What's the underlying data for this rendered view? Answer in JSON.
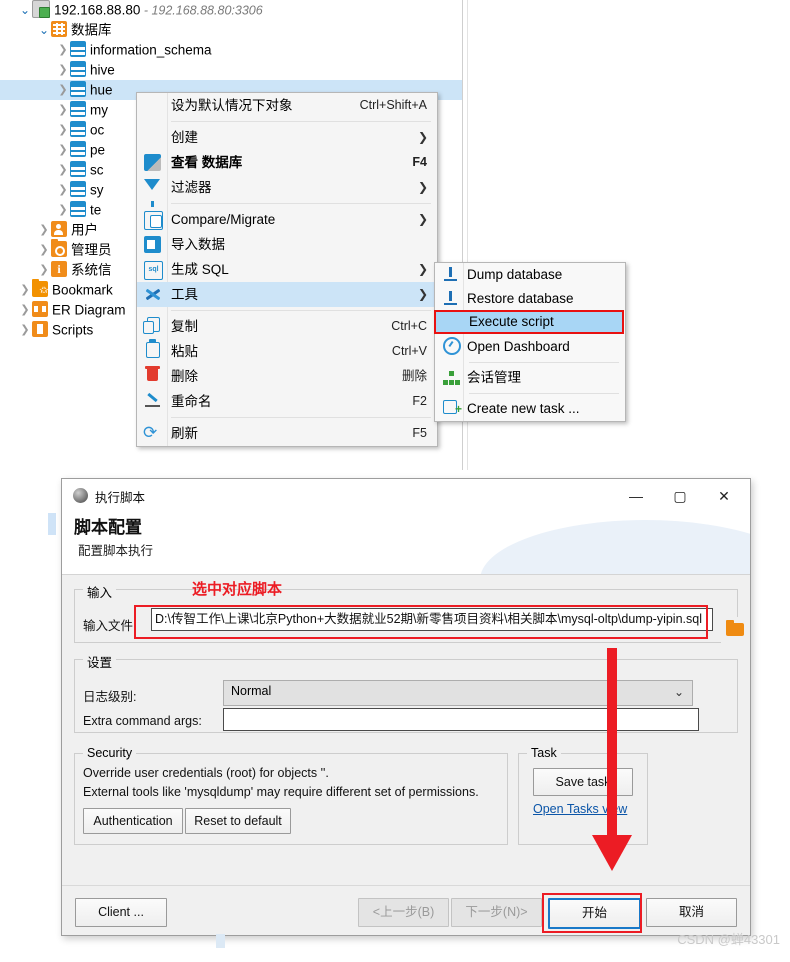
{
  "tree": {
    "items": [
      {
        "label": "192.168.88.80",
        "sub": "- 192.168.88.80:3306",
        "icon": "server-icon",
        "indent": 1,
        "twisty": "open"
      },
      {
        "label": "数据库",
        "sub": "",
        "icon": "grid-icon",
        "indent": 2,
        "twisty": "open"
      },
      {
        "label": "information_schema",
        "sub": "",
        "icon": "database-icon",
        "indent": 3,
        "twisty": "closed"
      },
      {
        "label": "hive",
        "sub": "",
        "icon": "database-icon",
        "indent": 3,
        "twisty": "closed"
      },
      {
        "label": "hue",
        "sub": "",
        "icon": "database-icon",
        "indent": 3,
        "twisty": "closed"
      },
      {
        "label": "my",
        "sub": "",
        "icon": "database-icon",
        "indent": 3,
        "twisty": "closed"
      },
      {
        "label": "oc",
        "sub": "",
        "icon": "database-icon",
        "indent": 3,
        "twisty": "closed"
      },
      {
        "label": "pe",
        "sub": "",
        "icon": "database-icon",
        "indent": 3,
        "twisty": "closed"
      },
      {
        "label": "sc",
        "sub": "",
        "icon": "database-icon",
        "indent": 3,
        "twisty": "closed"
      },
      {
        "label": "sy",
        "sub": "",
        "icon": "database-icon",
        "indent": 3,
        "twisty": "closed"
      },
      {
        "label": "te",
        "sub": "",
        "icon": "database-icon",
        "indent": 3,
        "twisty": "closed"
      },
      {
        "label": "用户",
        "sub": "",
        "icon": "user-icon",
        "indent": 2,
        "twisty": "closed"
      },
      {
        "label": "管理员",
        "sub": "",
        "icon": "key-folder-icon",
        "indent": 2,
        "twisty": "closed"
      },
      {
        "label": "系统信",
        "sub": "",
        "icon": "info-icon",
        "indent": 2,
        "twisty": "closed"
      },
      {
        "label": "Bookmark",
        "sub": "",
        "icon": "bookmark-folder-icon",
        "indent": 1,
        "twisty": "closed"
      },
      {
        "label": "ER Diagram",
        "sub": "",
        "icon": "er-diagram-icon",
        "indent": 1,
        "twisty": "closed"
      },
      {
        "label": "Scripts",
        "sub": "",
        "icon": "scripts-folder-icon",
        "indent": 1,
        "twisty": "closed"
      }
    ],
    "selected_index": 4
  },
  "context_menu": {
    "items": [
      {
        "label": "设为默认情况下对象",
        "accel": "Ctrl+Shift+A",
        "icon": "",
        "arrow": false,
        "bold": false
      },
      {
        "sep": true
      },
      {
        "label": "创建",
        "accel": "",
        "icon": "",
        "arrow": true,
        "bold": false
      },
      {
        "label": "查看 数据库",
        "accel": "F4",
        "icon": "pencil-icon",
        "arrow": false,
        "bold": true
      },
      {
        "label": "过滤器",
        "accel": "",
        "icon": "filter-icon",
        "arrow": true,
        "bold": false
      },
      {
        "sep": true
      },
      {
        "label": "Compare/Migrate",
        "accel": "",
        "icon": "compare-icon",
        "arrow": true,
        "bold": false
      },
      {
        "label": "导入数据",
        "accel": "",
        "icon": "import-icon",
        "arrow": false,
        "bold": false
      },
      {
        "label": "生成 SQL",
        "accel": "",
        "icon": "sql-icon",
        "arrow": true,
        "bold": false
      },
      {
        "label": "工具",
        "accel": "",
        "icon": "tools-icon",
        "arrow": true,
        "bold": false,
        "highlighted": true
      },
      {
        "sep": true
      },
      {
        "label": "复制",
        "accel": "Ctrl+C",
        "icon": "copy-icon",
        "arrow": false,
        "bold": false
      },
      {
        "label": "粘贴",
        "accel": "Ctrl+V",
        "icon": "paste-icon",
        "arrow": false,
        "bold": false
      },
      {
        "label": "删除",
        "accel": "删除",
        "icon": "trash-icon",
        "arrow": false,
        "bold": false
      },
      {
        "label": "重命名",
        "accel": "F2",
        "icon": "rename-icon",
        "arrow": false,
        "bold": false
      },
      {
        "sep": true
      },
      {
        "label": "刷新",
        "accel": "F5",
        "icon": "refresh-icon",
        "arrow": false,
        "bold": false
      }
    ]
  },
  "sub_menu": {
    "items": [
      {
        "label": "Dump database",
        "icon": "upload-icon"
      },
      {
        "label": "Restore database",
        "icon": "download-icon"
      },
      {
        "label": "Execute script",
        "icon": "",
        "highlighted": true
      },
      {
        "label": "Open Dashboard",
        "icon": "gauge-icon"
      },
      {
        "sep": true
      },
      {
        "label": "会话管理",
        "icon": "network-icon"
      },
      {
        "sep": true
      },
      {
        "label": "Create new task ...",
        "icon": "new-task-icon"
      }
    ]
  },
  "dialog": {
    "window_title": "执行脚本",
    "header_title": "脚本配置",
    "header_subtitle": "配置脚本执行",
    "input_group_label": "输入",
    "input_file_label": "输入文件:",
    "input_file_value": "D:\\传智工作\\上课\\北京Python+大数据就业52期\\新零售项目资料\\相关脚本\\mysql-oltp\\dump-yipin.sql",
    "settings_group_label": "设置",
    "log_level_label": "日志级别:",
    "log_level_value": "Normal",
    "extra_args_label": "Extra command args:",
    "extra_args_value": "",
    "security_group_label": "Security",
    "security_line1": "Override user credentials (root) for objects ''.",
    "security_line2": "External tools like 'mysqldump' may require different set of permissions.",
    "auth_button": "Authentication",
    "reset_button": "Reset to default",
    "task_group_label": "Task",
    "save_task_button": "Save task",
    "open_tasks_link": "Open Tasks view",
    "client_button": "Client ...",
    "back_button": "<上一步(B)",
    "next_button": "下一步(N)>",
    "start_button": "开始",
    "cancel_button": "取消",
    "minimize_glyph": "—",
    "maximize_glyph": "▢",
    "close_glyph": "✕"
  },
  "annotations": {
    "select_script_text": "选中对应脚本",
    "accent_red": "#ec1c24",
    "highlight_blue": "#cce4f7"
  },
  "watermark": "CSDN @蝉43301"
}
